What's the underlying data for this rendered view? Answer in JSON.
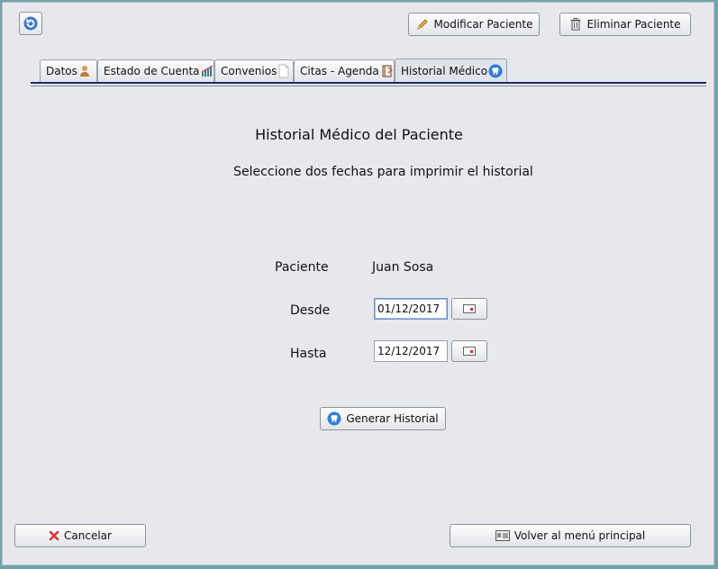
{
  "toolbar": {
    "refresh_icon": "refresh-icon",
    "modify_label": "Modificar Paciente",
    "delete_label": "Eliminar Paciente"
  },
  "tabs": [
    {
      "label": "Datos",
      "icon": "user-icon"
    },
    {
      "label": "Estado de Cuenta",
      "icon": "chart-icon"
    },
    {
      "label": "Convenios",
      "icon": "document-icon"
    },
    {
      "label": "Citas - Agenda",
      "icon": "agenda-icon"
    },
    {
      "label": "Historial Médico",
      "icon": "tooth-icon",
      "active": true
    }
  ],
  "main": {
    "title": "Historial Médico del Paciente",
    "subtitle": "Seleccione dos fechas para imprimir el historial",
    "patient_label": "Paciente",
    "patient_value": "Juan Sosa",
    "from_label": "Desde",
    "from_value": "01/12/2017",
    "to_label": "Hasta",
    "to_value": "12/12/2017",
    "generate_label": "Generar Historial"
  },
  "footer": {
    "cancel_label": "Cancelar",
    "back_label": "Volver al menú principal"
  },
  "colors": {
    "accent": "#1b2a66",
    "window_bg": "#e6e8ee",
    "outer_bg": "#6fa3ad"
  }
}
